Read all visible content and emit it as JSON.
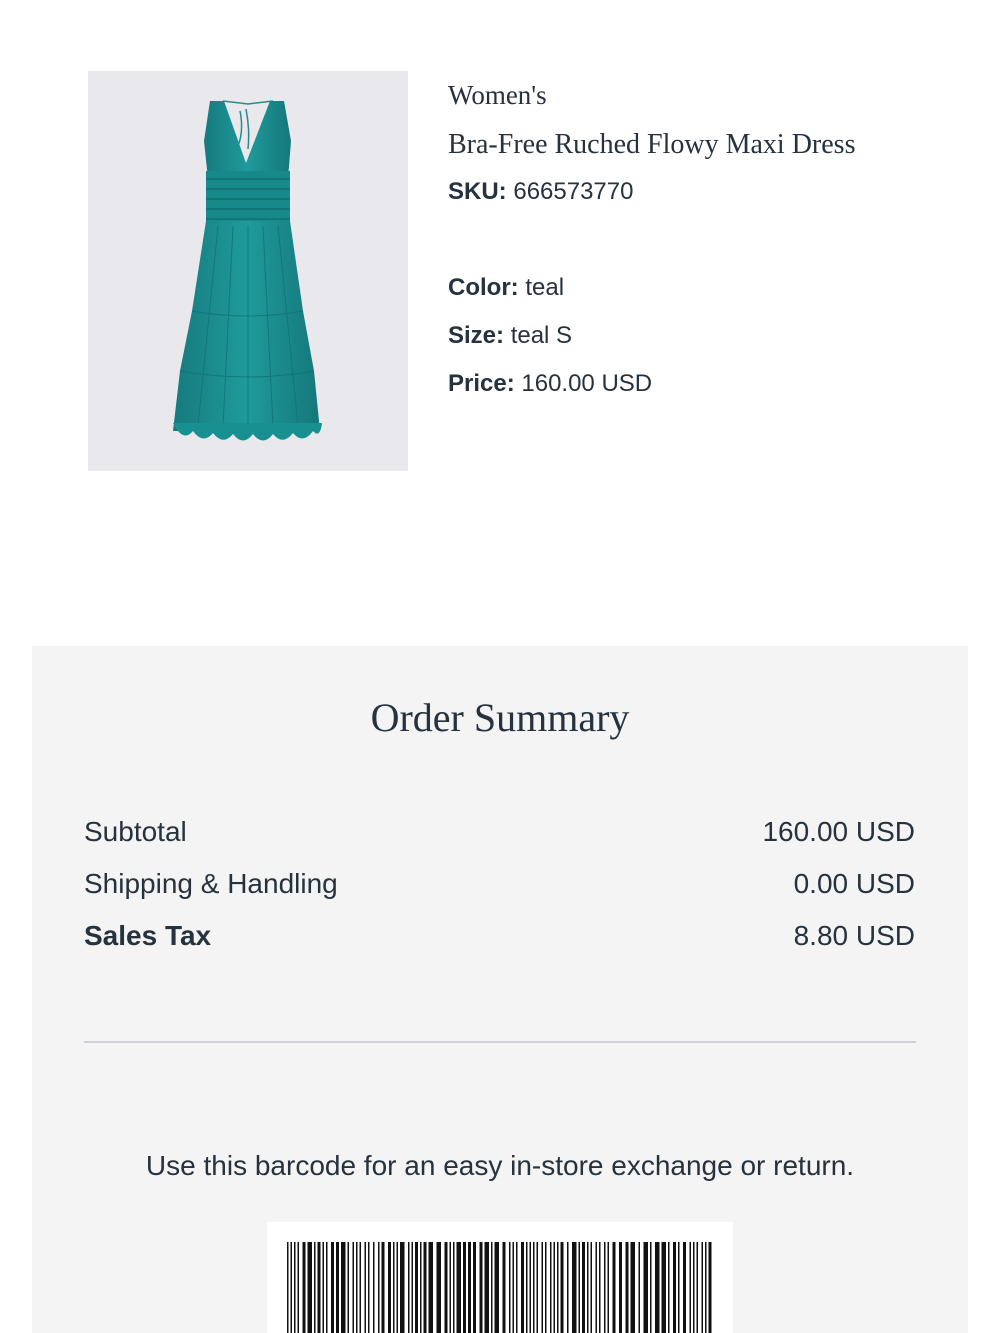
{
  "product": {
    "image_alt": "teal maxi dress",
    "gender": "Women's",
    "name": "Bra-Free Ruched Flowy Maxi Dress",
    "sku_label": "SKU:",
    "sku": "666573770",
    "color_label": "Color:",
    "color": "teal",
    "size_label": "Size:",
    "size": "teal S",
    "price_label": "Price:",
    "price": "160.00 USD"
  },
  "summary": {
    "title": "Order Summary",
    "rows": [
      {
        "label": "Subtotal",
        "value": "160.00 USD"
      },
      {
        "label": "Shipping & Handling",
        "value": "0.00 USD"
      },
      {
        "label": "Sales Tax",
        "value": "8.80 USD"
      }
    ],
    "barcode_note": "Use this barcode for an easy in-store exchange or return."
  },
  "colors": {
    "text": "#26323e",
    "summary_background": "#f4f4f4",
    "image_background": "#e9e8ec",
    "dress": "#1b8b8e"
  }
}
